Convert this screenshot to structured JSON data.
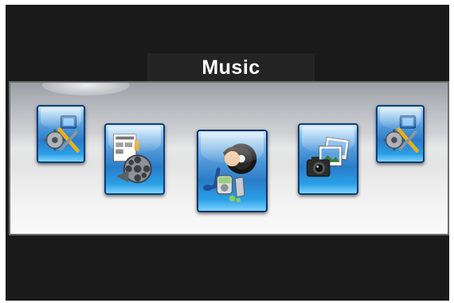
{
  "menu": {
    "selected_title": "Music",
    "items": [
      {
        "id": "setup-left",
        "icon": "setup-tools-icon",
        "selected": false
      },
      {
        "id": "movie",
        "icon": "movie-reel-icon",
        "selected": false
      },
      {
        "id": "music",
        "icon": "music-icon",
        "selected": true
      },
      {
        "id": "photo",
        "icon": "photo-camera-icon",
        "selected": false
      },
      {
        "id": "setup-right",
        "icon": "setup-tools-icon",
        "selected": false
      }
    ]
  },
  "colors": {
    "background": "#1a1a1a",
    "tile_blue": "#2a7cc8",
    "band_light": "#f4f4f4",
    "title_text": "#ffffff"
  }
}
